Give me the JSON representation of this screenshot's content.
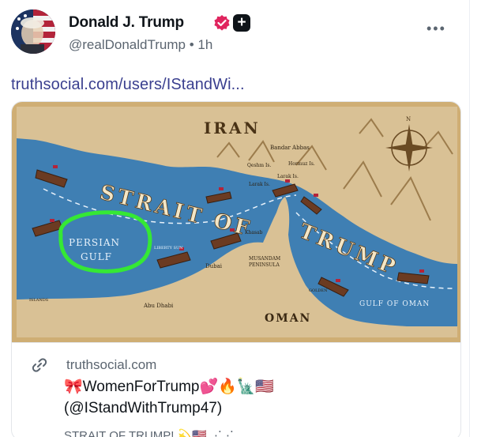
{
  "post": {
    "author_name": "Donald J. Trump",
    "handle": "@realDonaldTrump",
    "separator": "•",
    "time": "1h",
    "more_label": "•••",
    "plus_label": "+",
    "link_text": "truthsocial.com/users/IStandWi..."
  },
  "card": {
    "domain": "truthsocial.com",
    "title_line1": "🎀WomenForTrump💕🔥🗽🇺🇸",
    "title_line2": "(@IStandWithTrump47)",
    "description": "STRAIT OF TRUMP! 💫🇺🇸 ⋰⋰",
    "map": {
      "labels": {
        "iran": "IRAN",
        "strait_of": "STRAIT OF",
        "trump": "TRUMP",
        "persian": "PERSIAN",
        "gulf": "GULF",
        "oman": "OMAN",
        "gulf_of_oman": "GULF OF OMAN",
        "bandar_abbas": "Bandar Abbas",
        "qeshm": "Qeshm Is.",
        "larak": "Larak Is.",
        "hormuz": "Hormuz Is.",
        "larak_is": "Larak Is.",
        "khasab": "Khasab",
        "musandam": "MUSANDAM",
        "peninsula": "PENINSULA",
        "dubai": "Dubai",
        "abu_dhabi": "Abu Dhabi",
        "islands": "ISLANDS",
        "compass_n": "N",
        "liberty": "LIBERTY SUN",
        "golden": "GOLDEN"
      }
    }
  },
  "colors": {
    "link": "#3a3f8f",
    "verified": "#e0245e",
    "sea": "#3f7fb3",
    "land": "#d9c195",
    "circle": "#35e835"
  }
}
